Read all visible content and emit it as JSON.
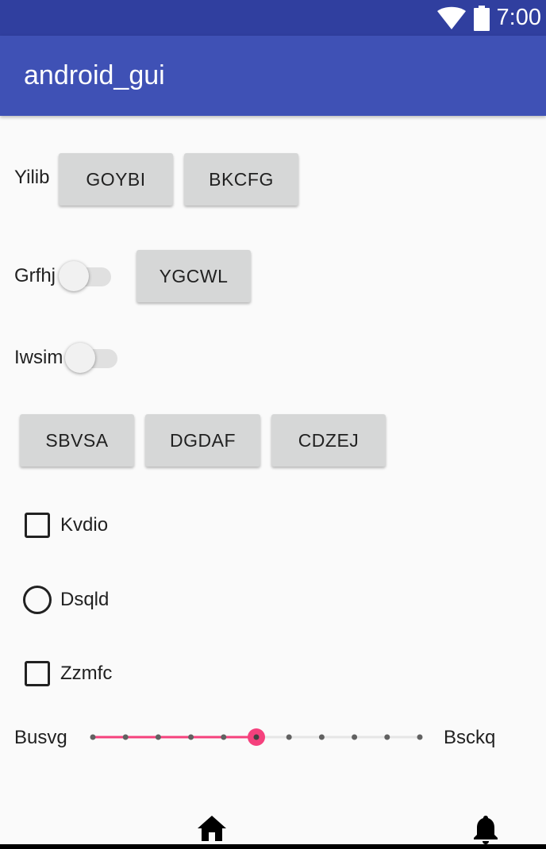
{
  "status_bar": {
    "time": "7:00",
    "icons": [
      "wifi-icon",
      "battery-icon"
    ]
  },
  "app_bar": {
    "title": "android_gui"
  },
  "row1": {
    "label": "Yilib",
    "button1": "GOYBI",
    "button2": "BKCFG"
  },
  "row2": {
    "label": "Grfhj",
    "switch_on": false,
    "button": "YGCWL"
  },
  "row3": {
    "label": "Iwsim",
    "switch_on": false
  },
  "row4": {
    "buttons": [
      "SBVSA",
      "DGDAF",
      "CDZEJ"
    ]
  },
  "checkbox1": {
    "label": "Kvdio",
    "checked": false
  },
  "radio1": {
    "label": "Dsqld",
    "checked": false
  },
  "checkbox2": {
    "label": "Zzmfc",
    "checked": false
  },
  "slider": {
    "left_label": "Busvg",
    "right_label": "Bsckq",
    "steps": 10,
    "value": 5,
    "accent": "#f5417d"
  },
  "bottom_nav": {
    "icons": [
      "home-icon",
      "notifications-icon"
    ]
  },
  "colors": {
    "primary": "#3f51b5",
    "primary_dark": "#303f9f",
    "accent": "#ff4081"
  }
}
